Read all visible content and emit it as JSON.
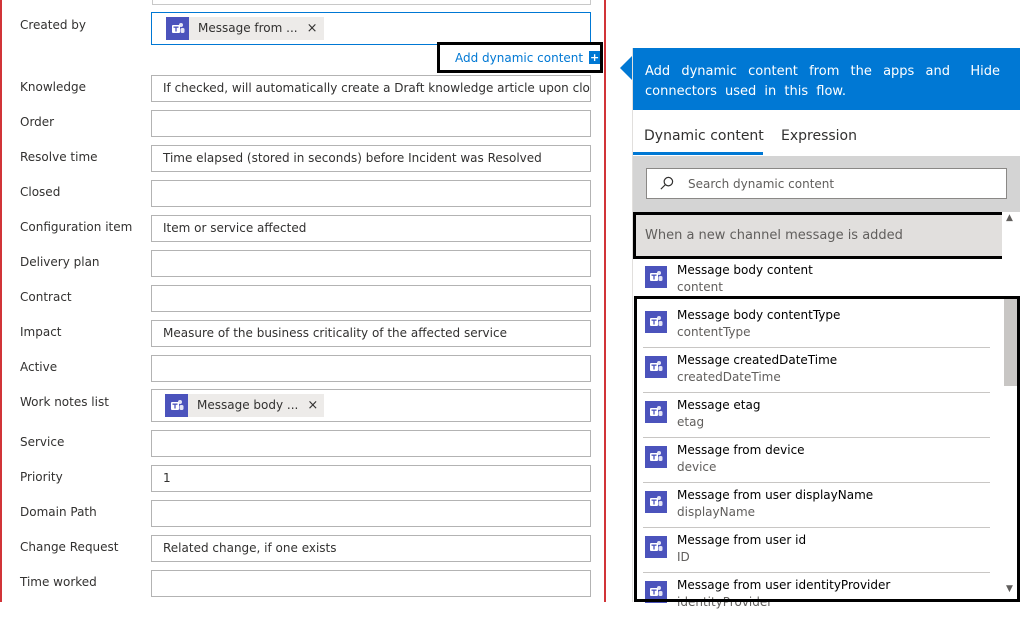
{
  "form": {
    "fields": [
      {
        "id": "created-by",
        "label": "Created by",
        "value": "",
        "token": "Message from ..."
      },
      {
        "id": "knowledge",
        "label": "Knowledge",
        "value": "If checked, will automatically create a Draft knowledge article upon closure"
      },
      {
        "id": "order",
        "label": "Order",
        "value": ""
      },
      {
        "id": "resolve-time",
        "label": "Resolve time",
        "value": "Time elapsed (stored in seconds) before Incident was Resolved"
      },
      {
        "id": "closed",
        "label": "Closed",
        "value": ""
      },
      {
        "id": "configuration-item",
        "label": "Configuration item",
        "value": "Item or service affected"
      },
      {
        "id": "delivery-plan",
        "label": "Delivery plan",
        "value": ""
      },
      {
        "id": "contract",
        "label": "Contract",
        "value": ""
      },
      {
        "id": "impact",
        "label": "Impact",
        "value": "Measure of the business criticality of the affected service"
      },
      {
        "id": "active",
        "label": "Active",
        "value": ""
      },
      {
        "id": "work-notes-list",
        "label": "Work notes list",
        "value": "",
        "token": "Message body ..."
      },
      {
        "id": "service",
        "label": "Service",
        "value": ""
      },
      {
        "id": "priority",
        "label": "Priority",
        "value": "1"
      },
      {
        "id": "domain-path",
        "label": "Domain Path",
        "value": ""
      },
      {
        "id": "change-request",
        "label": "Change Request",
        "value": "Related change, if one exists"
      },
      {
        "id": "time-worked",
        "label": "Time worked",
        "value": ""
      }
    ],
    "add_dynamic_label": "Add dynamic content",
    "token_remove": "×"
  },
  "flyout": {
    "description": "Add dynamic content from the apps and connectors used in this flow.",
    "hide_label": "Hide",
    "tabs": {
      "dynamic": "Dynamic content",
      "expression": "Expression"
    },
    "search_placeholder": "Search dynamic content",
    "section_title": "When a new channel message is added",
    "items": [
      {
        "title": "Message body content",
        "sub": "content"
      },
      {
        "title": "Message body contentType",
        "sub": "contentType"
      },
      {
        "title": "Message createdDateTime",
        "sub": "createdDateTime"
      },
      {
        "title": "Message etag",
        "sub": "etag"
      },
      {
        "title": "Message from device",
        "sub": "device"
      },
      {
        "title": "Message from user displayName",
        "sub": "displayName"
      },
      {
        "title": "Message from user id",
        "sub": "ID"
      },
      {
        "title": "Message from user identityProvider",
        "sub": "identityProvider"
      }
    ]
  },
  "colors": {
    "accent": "#0078d4",
    "teams": "#4b53bc",
    "error_border": "#d13438"
  },
  "icons": {
    "app": "teams-icon",
    "search": "search-icon",
    "add": "plus-icon",
    "remove": "close-icon"
  }
}
